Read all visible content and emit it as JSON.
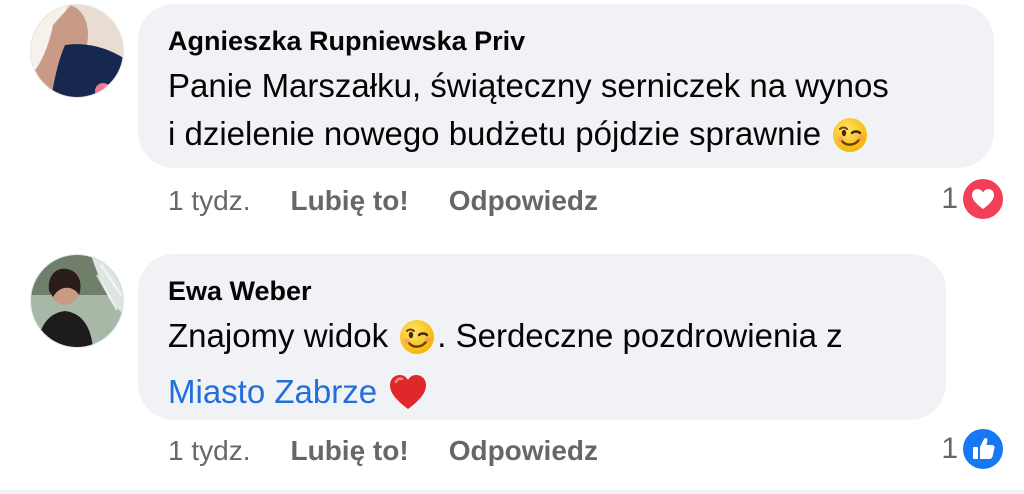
{
  "comments": [
    {
      "author": "Agnieszka Rupniewska Priv",
      "text_line1": "Panie Marszałku, świąteczny serniczek na wynos",
      "text_line2": "i dzielenie nowego budżetu pójdzie sprawnie",
      "emoji": "winking-face",
      "time": "1 tydz.",
      "like_label": "Lubię to!",
      "reply_label": "Odpowiedz",
      "reaction_count": "1",
      "reaction_type": "love",
      "reaction_color": "#f33e58"
    },
    {
      "author": "Ewa Weber",
      "text_before_emoji": "Znajomy widok",
      "text_after_emoji": ". Serdeczne pozdrowienia z",
      "mention": "Miasto Zabrze",
      "emoji": "winking-face",
      "emoji2": "red-heart",
      "time": "1 tydz.",
      "like_label": "Lubię to!",
      "reply_label": "Odpowiedz",
      "reaction_count": "1",
      "reaction_type": "like",
      "reaction_color": "#1877f2"
    }
  ],
  "colors": {
    "bubble": "#f0f2f5",
    "text": "#050505",
    "secondary": "#65676b",
    "link": "#216fdb"
  }
}
